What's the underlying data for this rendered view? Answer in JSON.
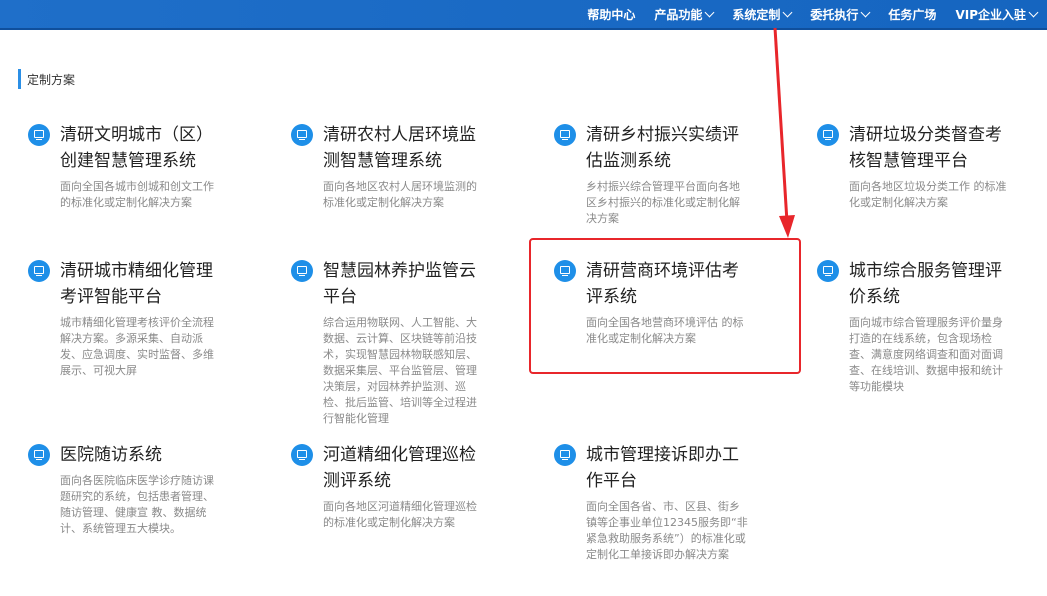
{
  "nav": [
    {
      "label": "帮助中心",
      "dropdown": false
    },
    {
      "label": "产品功能",
      "dropdown": true
    },
    {
      "label": "系统定制",
      "dropdown": true
    },
    {
      "label": "委托执行",
      "dropdown": true
    },
    {
      "label": "任务广场",
      "dropdown": false
    },
    {
      "label": "VIP企业入驻",
      "dropdown": true
    }
  ],
  "section": {
    "title": "定制方案"
  },
  "cards": [
    {
      "title": "清研文明城市（区）创建智慧管理系统",
      "desc": "面向全国各城市创城和创文工作的标准化或定制化解决方案"
    },
    {
      "title": "清研农村人居环境监测智慧管理系统",
      "desc": "面向各地区农村人居环境监测的标准化或定制化解决方案"
    },
    {
      "title": "清研乡村振兴实绩评估监测系统",
      "desc": "乡村振兴综合管理平台面向各地区乡村振兴的标准化或定制化解决方案"
    },
    {
      "title": "清研垃圾分类督查考核智慧管理平台",
      "desc": "面向各地区垃圾分类工作 的标准化或定制化解决方案"
    },
    {
      "title": "清研城市精细化管理考评智能平台",
      "desc": "城市精细化管理考核评价全流程解决方案。多源采集、自动派发、应急调度、实时监督、多维展示、可视大屏"
    },
    {
      "title": "智慧园林养护监管云平台",
      "desc": "综合运用物联网、人工智能、大数据、云计算、区块链等前沿技术，实现智慧园林物联感知层、数据采集层、平台监管层、管理决策层，对园林养护监测、巡检、批后监管、培训等全过程进行智能化管理"
    },
    {
      "title": "清研营商环境评估考评系统",
      "desc": "面向全国各地营商环境评估 的标准化或定制化解决方案"
    },
    {
      "title": "城市综合服务管理评价系统",
      "desc": "面向城市综合管理服务评价量身打造的在线系统，包含现场检查、满意度网络调查和面对面调查、在线培训、数据申报和统计等功能模块"
    },
    {
      "title": "医院随访系统",
      "desc": "面向各医院临床医学诊疗随访课题研究的系统，包括患者管理、随访管理、健康宣 教、数据统计、系统管理五大模块。"
    },
    {
      "title": "河道精细化管理巡检测评系统",
      "desc": "面向各地区河道精细化管理巡检 的标准化或定制化解决方案"
    },
    {
      "title": "城市管理接诉即办工作平台",
      "desc": "面向全国各省、市、区县、街乡镇等企事业单位12345服务即“非紧急救助服务系统”）的标准化或定制化工单接诉即办解决方案"
    }
  ],
  "colors": {
    "topbar": "#1565c0",
    "accent": "#1e8fe8",
    "highlight": "#e8262b"
  }
}
